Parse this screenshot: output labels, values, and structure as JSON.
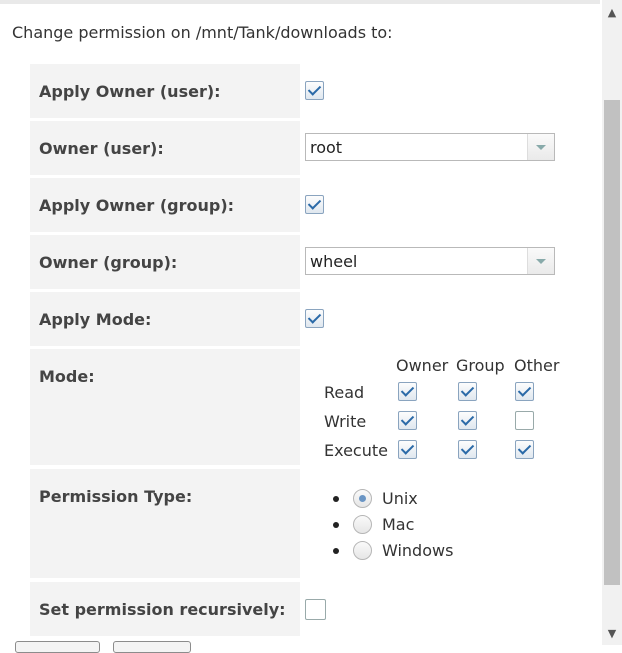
{
  "dialog": {
    "heading": "Change permission on /mnt/Tank/downloads to:"
  },
  "form": {
    "apply_owner_user": {
      "label": "Apply Owner (user):",
      "checked": true
    },
    "owner_user": {
      "label": "Owner (user):",
      "value": "root"
    },
    "apply_owner_group": {
      "label": "Apply Owner (group):",
      "checked": true
    },
    "owner_group": {
      "label": "Owner (group):",
      "value": "wheel"
    },
    "apply_mode": {
      "label": "Apply Mode:",
      "checked": true
    },
    "mode": {
      "label": "Mode:",
      "columns": [
        "Owner",
        "Group",
        "Other"
      ],
      "rows": [
        {
          "name": "Read",
          "values": [
            true,
            true,
            true
          ]
        },
        {
          "name": "Write",
          "values": [
            true,
            true,
            false
          ]
        },
        {
          "name": "Execute",
          "values": [
            true,
            true,
            true
          ]
        }
      ]
    },
    "permission_type": {
      "label": "Permission Type:",
      "options": [
        "Unix",
        "Mac",
        "Windows"
      ],
      "selected": "Unix"
    },
    "set_recursive": {
      "label": "Set permission recursively:",
      "checked": false
    }
  },
  "icons": {
    "scroll_up": "scroll-up-arrow-icon",
    "scroll_down": "scroll-down-arrow-icon",
    "select_arrow": "chevron-down-icon"
  }
}
